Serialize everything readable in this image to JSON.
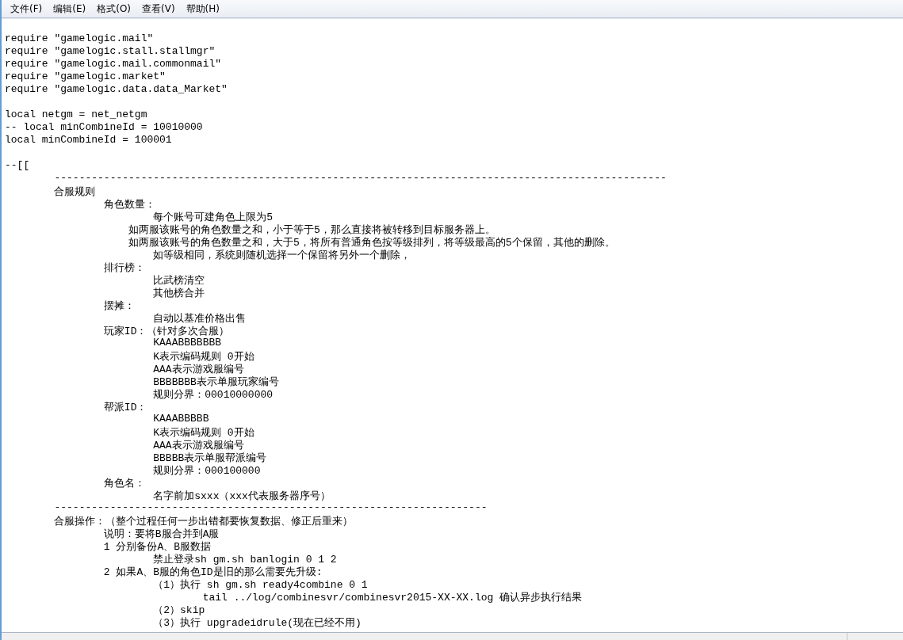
{
  "menu": [
    {
      "label": "文件(F)"
    },
    {
      "label": "编辑(E)"
    },
    {
      "label": "格式(O)"
    },
    {
      "label": "查看(V)"
    },
    {
      "label": "帮助(H)"
    }
  ],
  "lines": [
    {
      "kind": "blank"
    },
    {
      "kind": "text",
      "text": "require \"gamelogic.mail\""
    },
    {
      "kind": "text",
      "text": "require \"gamelogic.stall.stallmgr\""
    },
    {
      "kind": "text",
      "text": "require \"gamelogic.mail.commonmail\""
    },
    {
      "kind": "text",
      "text": "require \"gamelogic.market\""
    },
    {
      "kind": "text",
      "text": "require \"gamelogic.data.data_Market\""
    },
    {
      "kind": "blank"
    },
    {
      "kind": "text",
      "text": "local netgm = net_netgm"
    },
    {
      "kind": "text",
      "text": "-- local minCombineId = 10010000"
    },
    {
      "kind": "text",
      "text": "local minCombineId = 100001"
    },
    {
      "kind": "blank"
    },
    {
      "kind": "text",
      "text": "--[["
    },
    {
      "kind": "text",
      "text": "\t---------------------------------------------------------------------------------------------------"
    },
    {
      "kind": "text",
      "text": "\t合服规则"
    },
    {
      "kind": "text",
      "text": "\t\t角色数量："
    },
    {
      "kind": "text",
      "text": "\t\t\t每个账号可建角色上限为5"
    },
    {
      "kind": "text",
      "text": "\t\t    如两服该账号的角色数量之和，小于等于5，那么直接将被转移到目标服务器上。"
    },
    {
      "kind": "text",
      "text": "\t\t    如两服该账号的角色数量之和，大于5，将所有普通角色按等级排列，将等级最高的5个保留，其他的删除。"
    },
    {
      "kind": "text",
      "text": "\t\t\t如等级相同，系统则随机选择一个保留将另外一个删除，"
    },
    {
      "kind": "text",
      "text": "\t\t排行榜："
    },
    {
      "kind": "text",
      "text": "\t\t\t比武榜清空"
    },
    {
      "kind": "text",
      "text": "\t\t\t其他榜合并"
    },
    {
      "kind": "text",
      "text": "\t\t摆摊："
    },
    {
      "kind": "text",
      "text": "\t\t\t自动以基准价格出售"
    },
    {
      "kind": "text",
      "text": "\t\t玩家ID：（针对多次合服）"
    },
    {
      "kind": "text",
      "text": "\t\t\tKAAABBBBBBB"
    },
    {
      "kind": "text",
      "text": "\t\t\tK表示编码规则 0开始"
    },
    {
      "kind": "text",
      "text": "\t\t\tAAA表示游戏服编号"
    },
    {
      "kind": "text",
      "text": "\t\t\tBBBBBBB表示单服玩家编号"
    },
    {
      "kind": "text",
      "text": "\t\t\t规则分界：00010000000"
    },
    {
      "kind": "text",
      "text": "\t\t帮派ID："
    },
    {
      "kind": "text",
      "text": "\t\t\tKAAABBBBB"
    },
    {
      "kind": "text",
      "text": "\t\t\tK表示编码规则 0开始"
    },
    {
      "kind": "text",
      "text": "\t\t\tAAA表示游戏服编号"
    },
    {
      "kind": "text",
      "text": "\t\t\tBBBBB表示单服帮派编号"
    },
    {
      "kind": "text",
      "text": "\t\t\t规则分界：000100000"
    },
    {
      "kind": "text",
      "text": "\t\t角色名："
    },
    {
      "kind": "text",
      "text": "\t\t\t名字前加sxxx（xxx代表服务器序号）"
    },
    {
      "kind": "text",
      "text": "\t----------------------------------------------------------------------"
    },
    {
      "kind": "text",
      "text": "\t合服操作：（整个过程任何一步出错都要恢复数据、修正后重来）"
    },
    {
      "kind": "text",
      "text": "\t\t说明：要将B服合并到A服"
    },
    {
      "kind": "text",
      "text": "\t\t1 分别备份A、B服数据"
    },
    {
      "kind": "text",
      "text": "\t\t\t禁止登录sh gm.sh banlogin 0 1 2"
    },
    {
      "kind": "text",
      "text": "\t\t2 如果A、B服的角色ID是旧的那么需要先升级:"
    },
    {
      "kind": "text",
      "text": "\t\t\t（1）执行 sh gm.sh ready4combine 0 1"
    },
    {
      "kind": "text",
      "text": "\t\t\t\ttail ../log/combinesvr/combinesvr2015-XX-XX.log 确认异步执行结果"
    },
    {
      "kind": "text",
      "text": "\t\t\t（2）skip"
    },
    {
      "kind": "text",
      "text": "\t\t\t（3）执行 upgradeidrule(现在已经不用)"
    }
  ]
}
